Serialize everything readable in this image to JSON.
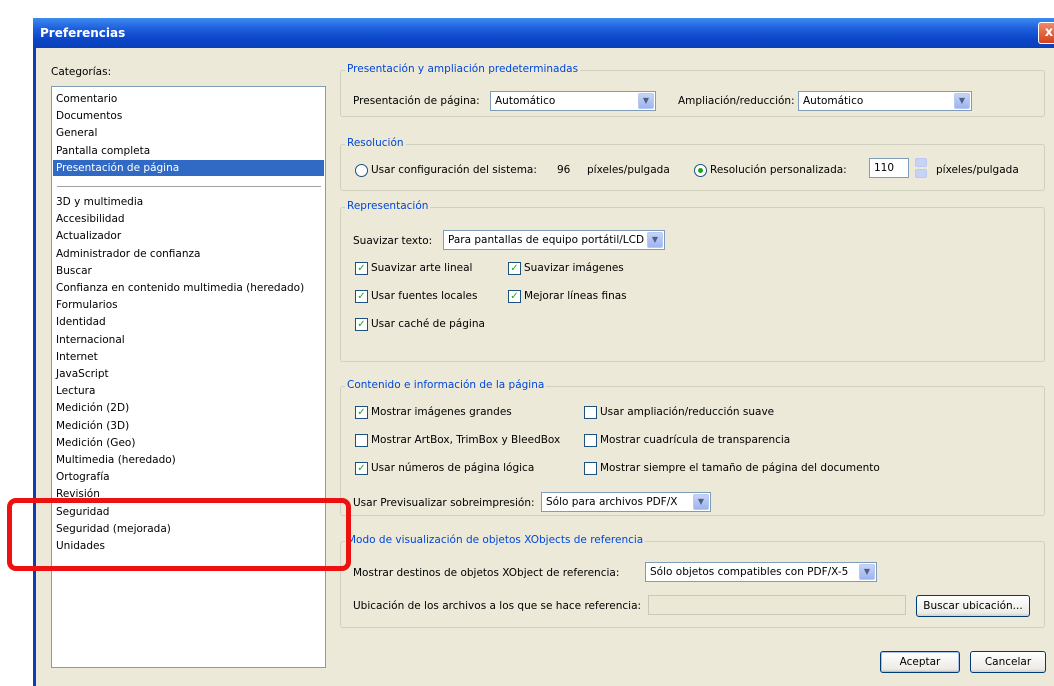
{
  "window": {
    "title": "Preferencias",
    "close": "x"
  },
  "categories": {
    "label": "Categorías:",
    "group1": [
      "Comentario",
      "Documentos",
      "General",
      "Pantalla completa",
      "Presentación de página"
    ],
    "selected_index": 4,
    "group2": [
      "3D y multimedia",
      "Accesibilidad",
      "Actualizador",
      "Administrador de confianza",
      "Buscar",
      "Confianza en contenido multimedia (heredado)",
      "Formularios",
      "Identidad",
      "Internacional",
      "Internet",
      "JavaScript",
      "Lectura",
      "Medición (2D)",
      "Medición (3D)",
      "Medición (Geo)",
      "Multimedia (heredado)",
      "Ortografía",
      "Revisión",
      "Seguridad",
      "Seguridad (mejorada)",
      "Unidades"
    ]
  },
  "presentation": {
    "title": "Presentación y ampliación predeterminadas",
    "page_label": "Presentación de página:",
    "page_value": "Automático",
    "zoom_label": "Ampliación/reducción:",
    "zoom_value": "Automático"
  },
  "resolution": {
    "title": "Resolución",
    "system_label": "Usar configuración del sistema:",
    "system_value": "96",
    "system_unit": "píxeles/pulgada",
    "custom_label": "Resolución personalizada:",
    "custom_value": "110",
    "custom_unit": "píxeles/pulgada",
    "custom_selected": true
  },
  "rendering": {
    "title": "Representación",
    "smooth_label": "Suavizar texto:",
    "smooth_value": "Para pantallas de equipo portátil/LCD",
    "options": [
      {
        "label": "Suavizar arte lineal",
        "checked": true
      },
      {
        "label": "Suavizar imágenes",
        "checked": true
      },
      {
        "label": "Usar fuentes locales",
        "checked": true
      },
      {
        "label": "Mejorar líneas finas",
        "checked": true
      },
      {
        "label": "Usar caché de página",
        "checked": true
      }
    ]
  },
  "content": {
    "title": "Contenido e información de la página",
    "options": [
      {
        "label": "Mostrar imágenes grandes",
        "checked": true
      },
      {
        "label": "Usar ampliación/reducción suave",
        "checked": false
      },
      {
        "label": "Mostrar ArtBox, TrimBox y BleedBox",
        "checked": false
      },
      {
        "label": "Mostrar cuadrícula de transparencia",
        "checked": false
      },
      {
        "label": "Usar números de página lógica",
        "checked": true
      },
      {
        "label": "Mostrar siempre el tamaño de página del documento",
        "checked": false
      }
    ],
    "overprint_label": "Usar Previsualizar sobreimpresión:",
    "overprint_value": "Sólo para archivos PDF/X"
  },
  "xobjects": {
    "title": "Modo de visualización de objetos XObjects de referencia",
    "targets_label": "Mostrar destinos de objetos XObject de referencia:",
    "targets_value": "Sólo objetos compatibles con PDF/X-5",
    "location_label": "Ubicación de los archivos a los que se hace referencia:",
    "location_value": "",
    "browse_label": "Buscar ubicación..."
  },
  "buttons": {
    "ok": "Aceptar",
    "cancel": "Cancelar"
  },
  "icons": {
    "combo_arrow": "▼",
    "check": "✓",
    "spin_up": "▲",
    "spin_down": "▼"
  },
  "colors": {
    "title_bar": "#0a3fb8",
    "selection": "#316ac5",
    "group_title": "#0046d5",
    "highlight": "#ee1111"
  }
}
